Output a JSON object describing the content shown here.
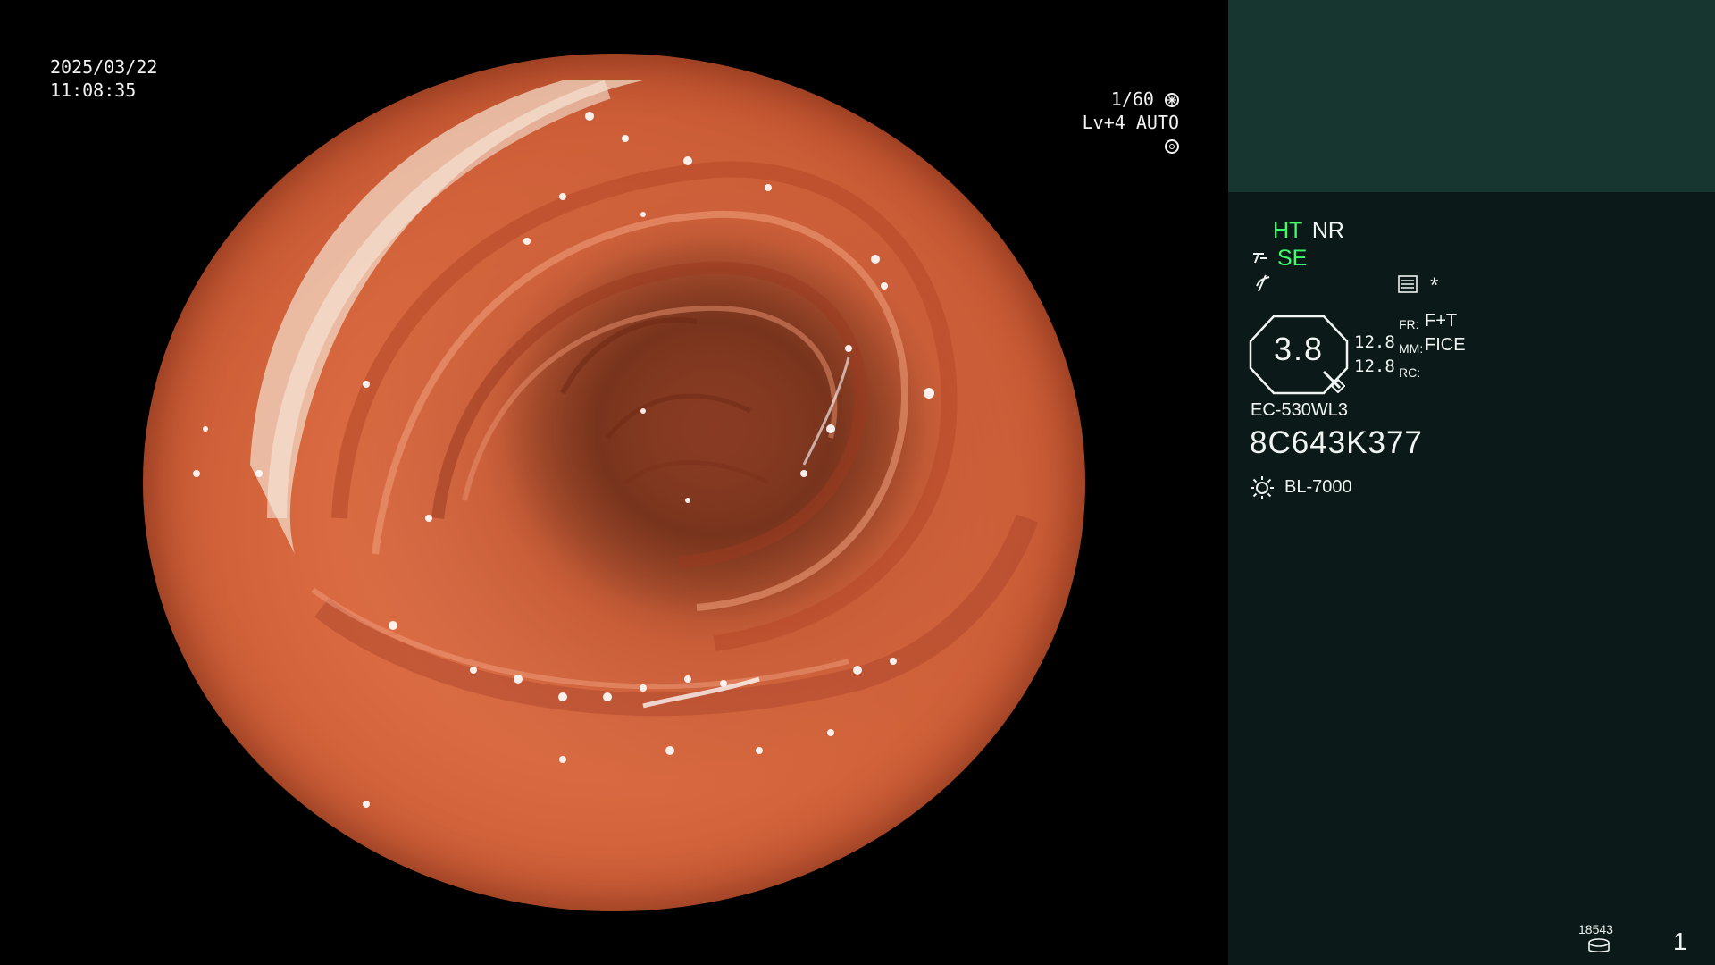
{
  "overlay": {
    "date": "2025/03/22",
    "time": "11:08:35",
    "shutter": "1/60",
    "shutter_icon": "aperture-icon",
    "level": "Lv+4",
    "exposure_mode": "AUTO",
    "exposure_icon": "iris-icon"
  },
  "panel": {
    "mode_ht": "HT",
    "mode_nr": "NR",
    "mode_se": "SE",
    "se_icon": "se-mode-icon",
    "enhance_icon": "enhance-icon",
    "menu_icon": "settings-list-icon",
    "asterisk": "*",
    "scope_diameter": "3.8",
    "scope_icon": "scope-tip-icon",
    "values": [
      "12.8",
      "12.8"
    ],
    "labels": {
      "fr": "FR:",
      "mm": "MM:",
      "rc": "RC:"
    },
    "fr_value": "F+T",
    "mm_value": "FICE",
    "rc_value": "",
    "scope_model": "EC-530WL3",
    "serial": "8C643K377",
    "light_source_icon": "sun-icon",
    "light_source": "BL-7000",
    "image_count": "18543",
    "storage_icon": "storage-disk-icon",
    "page_number": "1"
  },
  "colors": {
    "panel_bg": "#0b1a18",
    "panel_top": "#173630",
    "accent_green": "#3cff6a",
    "tissue": "#d8683f"
  }
}
